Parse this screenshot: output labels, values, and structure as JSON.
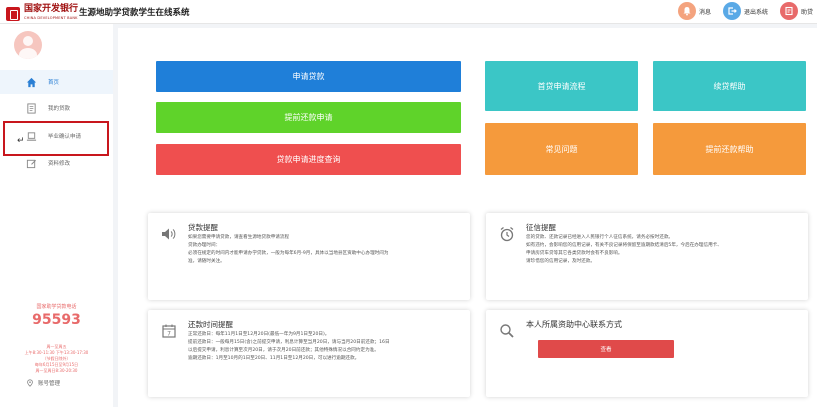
{
  "header": {
    "bank_name_cn": "国家开发银行",
    "bank_name_en": "CHINA DEVELOPMENT BANK",
    "system_title": "生源地助学贷款学生在线系统",
    "actions": [
      {
        "label": "消息",
        "icon": "bell-icon",
        "color": "#f4a37e"
      },
      {
        "label": "退出系统",
        "icon": "logout-icon",
        "color": "#5aa9e6"
      },
      {
        "label": "助贷",
        "icon": "help-icon",
        "color": "#e86a6a"
      }
    ]
  },
  "sidebar": {
    "items": [
      {
        "label": "首页",
        "icon": "home-icon"
      },
      {
        "label": "我的贷款",
        "icon": "loan-file-icon"
      },
      {
        "label": "毕业确认申请",
        "icon": "laptop-icon"
      },
      {
        "label": "资料修改",
        "icon": "edit-icon"
      }
    ],
    "hotline_label": "国家助学贷款电话",
    "hotline_number": "95593",
    "hotline_hours": [
      "周一至周五",
      "上午8:30-11:30 下午13:30-17:30",
      "（节假日除外）",
      "每年6月15日至9月15日",
      "周一至周日8:30-20:30"
    ],
    "account_mgmt": "账号管理"
  },
  "main": {
    "buttons_left": [
      {
        "label": "申请贷款",
        "color": "#1f7fd9"
      },
      {
        "label": "提前还款申请",
        "color": "#5fd32a"
      },
      {
        "label": "贷款申请进度查询",
        "color": "#ef4f4f"
      }
    ],
    "buttons_right": [
      {
        "label": "首贷申请流程",
        "color": "#3bc6c6"
      },
      {
        "label": "续贷帮助",
        "color": "#3bc6c6"
      },
      {
        "label": "常见问题",
        "color": "#f59a3c"
      },
      {
        "label": "提前还款帮助",
        "color": "#f59a3c"
      }
    ],
    "loan_notice": {
      "title": "贷款提醒",
      "lines": [
        "如果您需要申请贷款，请查看生源地贷款申请流程",
        "贷款办理时间：",
        "必须在规定的时间内才能申请办学贷款，一般为每年6月-9月，具体以当地县区资助中心办理时间为",
        "准，请随时关注。"
      ]
    },
    "credit_notice": {
      "title": "征信提醒",
      "lines": [
        "您的贷款、还款记录已经进入人民银行个人征信系统，请务必按时还款。",
        "如有违约，会影响您的信用记录，有关不良记录将保留至逾期款结清后5年，今后在办理信用卡、",
        "申请房贷车贷等其它各类贷款时会有不良影响。",
        "请珍惜您的信用记录，及时还款。"
      ]
    },
    "repay_notice": {
      "title": "还款时间提醒",
      "lines": [
        "正常还款日：每年11月1日至12月20日(最低一年为9月1日至20日)。",
        "提前还款日：一般每月15日(含)之前提交申请，利息计算至当月20日，请与当月20日前还款；16日",
        "以后提交申请，利息计算至次月20日，请于次月20日前还款；其他特殊情况以合同约定为准。",
        "逾期还款日：1月至10月的1日至20日、11月1日至12月20日，可以进行逾期还款。"
      ]
    },
    "contact": {
      "title": "本人所属资助中心联系方式",
      "button_label": "查看"
    }
  }
}
